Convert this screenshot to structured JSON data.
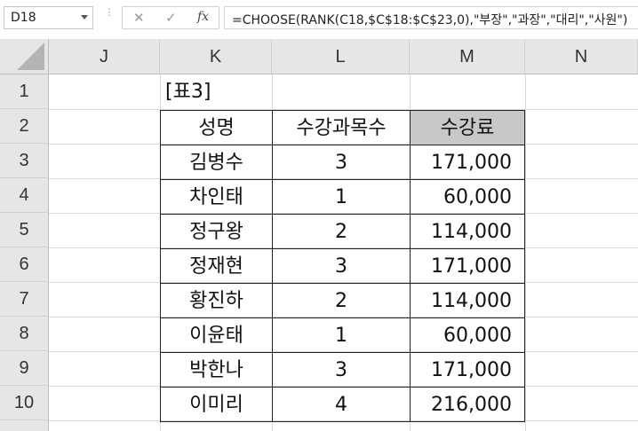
{
  "formula_bar": {
    "name_box": "D18",
    "cancel_icon": "✕",
    "enter_icon": "✓",
    "fx_label": "fx",
    "formula": "=CHOOSE(RANK(C18,$C$18:$C$23,0),\"부장\",\"과장\",\"대리\",\"사원\")"
  },
  "columns": [
    "J",
    "K",
    "L",
    "M",
    "N"
  ],
  "rows": [
    "1",
    "2",
    "3",
    "4",
    "5",
    "6",
    "7",
    "8",
    "9",
    "10"
  ],
  "table": {
    "title": "[표3]",
    "headers": [
      "성명",
      "수강과목수",
      "수강료"
    ],
    "records": [
      [
        "김병수",
        "3",
        "171,000"
      ],
      [
        "차인태",
        "1",
        "60,000"
      ],
      [
        "정구왕",
        "2",
        "114,000"
      ],
      [
        "정재현",
        "3",
        "171,000"
      ],
      [
        "황진하",
        "2",
        "114,000"
      ],
      [
        "이윤태",
        "1",
        "60,000"
      ],
      [
        "박한나",
        "3",
        "171,000"
      ],
      [
        "이미리",
        "4",
        "216,000"
      ]
    ]
  },
  "colors": {
    "header_shade": "#c8c8c8",
    "grid_line": "#dadada",
    "header_bg": "#e6e6e6"
  }
}
